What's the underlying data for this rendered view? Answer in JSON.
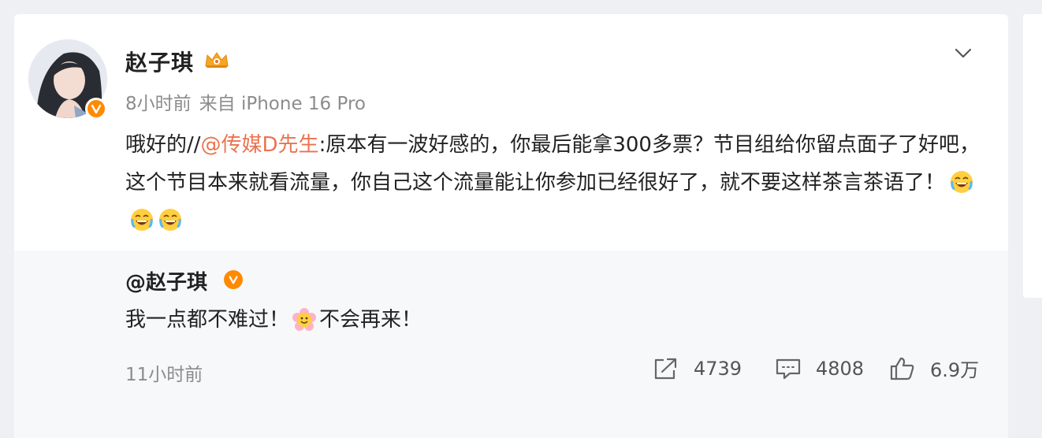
{
  "post": {
    "username": "赵子琪",
    "time": "8小时前",
    "source": "来自 iPhone 16 Pro",
    "text_prefix": "哦好的//",
    "mention": "@传媒D先生",
    "text_body": ":原本有一波好感的，你最后能拿300多票？节目组给你留点面子了好吧，这个节目本来就看流量，你自己这个流量能让你参加已经很好了，就不要这样茶言茶语了！"
  },
  "quoted": {
    "user": "@赵子琪",
    "text_before": "我一点都不难过！",
    "text_after": "不会再来！",
    "time": "11小时前",
    "repost_count": "4739",
    "comment_count": "4808",
    "like_count": "6.9万"
  },
  "colors": {
    "accent": "#eb7350",
    "verified": "#ff8a00",
    "text": "#222222",
    "muted": "#8c8c8c",
    "quote_bg": "#f7f8fa"
  },
  "icons": {
    "menu": "chevron-down-icon",
    "badge": "crown-icon",
    "verified": "verified-badge-icon",
    "repost": "repost-icon",
    "comment": "comment-icon",
    "like": "thumbs-up-icon",
    "emoji_text": "crying-laugh-emoji",
    "emoji_quote": "flower-face-emoji"
  }
}
